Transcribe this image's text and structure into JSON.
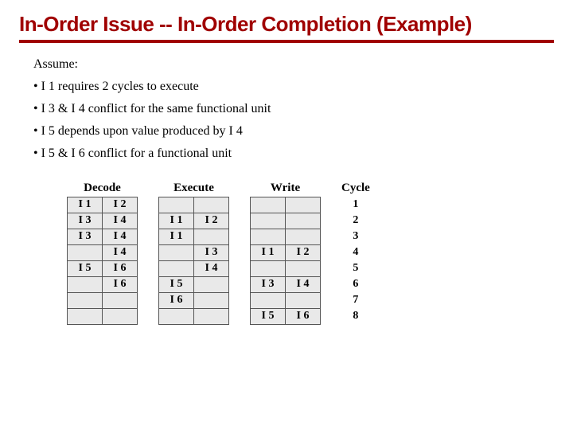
{
  "title": "In-Order Issue -- In-Order Completion (Example)",
  "assume_label": "Assume:",
  "bullets": [
    "• I 1 requires 2 cycles to execute",
    "• I 3 & I 4 conflict for the same functional unit",
    "• I 5 depends upon value produced by I 4",
    "• I 5 & I 6 conflict for a functional unit"
  ],
  "headers": {
    "decode": "Decode",
    "execute": "Execute",
    "write": "Write",
    "cycle": "Cycle"
  },
  "chart_data": {
    "type": "table",
    "cycles": [
      "1",
      "2",
      "3",
      "4",
      "5",
      "6",
      "7",
      "8"
    ],
    "decode": [
      [
        "I 1",
        "I 2"
      ],
      [
        "I 3",
        "I 4"
      ],
      [
        "I 3",
        "I 4"
      ],
      [
        "",
        "I 4"
      ],
      [
        "I 5",
        "I 6"
      ],
      [
        "",
        "I 6"
      ],
      [
        "",
        ""
      ],
      [
        "",
        ""
      ]
    ],
    "execute": [
      [
        "",
        ""
      ],
      [
        "I 1",
        "I 2"
      ],
      [
        "I 1",
        ""
      ],
      [
        "",
        "I 3"
      ],
      [
        "",
        "I 4"
      ],
      [
        "I 5",
        ""
      ],
      [
        "I 6",
        ""
      ],
      [
        "",
        ""
      ]
    ],
    "write": [
      [
        "",
        ""
      ],
      [
        "",
        ""
      ],
      [
        "",
        ""
      ],
      [
        "I 1",
        "I 2"
      ],
      [
        "",
        ""
      ],
      [
        "I 3",
        "I 4"
      ],
      [
        "",
        ""
      ],
      [
        "I 5",
        "I 6"
      ]
    ]
  }
}
